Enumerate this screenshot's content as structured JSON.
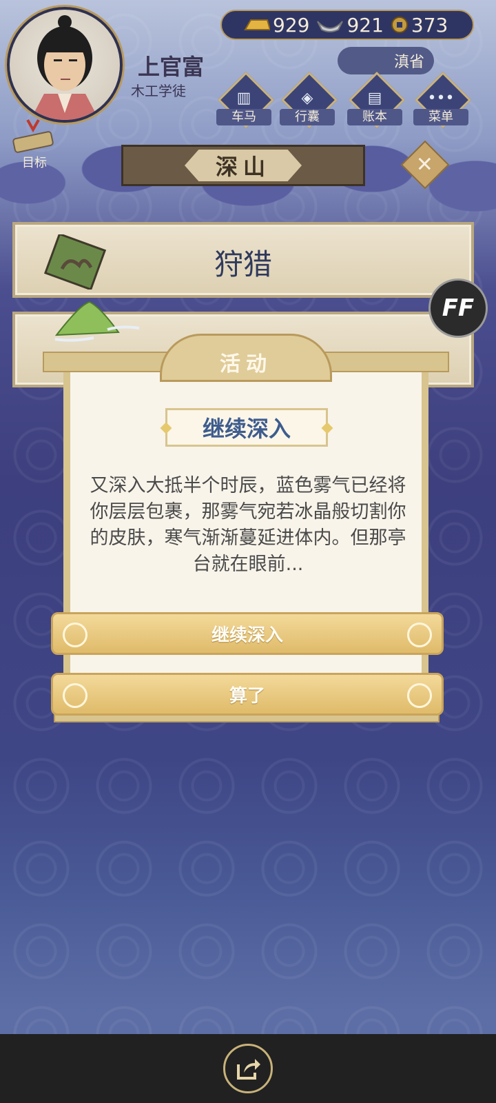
{
  "header": {
    "player_name": "上官富",
    "player_title": "木工学徒",
    "currencies": [
      {
        "icon": "gold-bar-icon",
        "value": "929"
      },
      {
        "icon": "silver-ingot-icon",
        "value": "921"
      },
      {
        "icon": "copper-coin-icon",
        "value": "373"
      }
    ],
    "province": "滇省",
    "nav": [
      {
        "label": "车马",
        "icon": "carriage-icon"
      },
      {
        "label": "行囊",
        "icon": "bag-icon"
      },
      {
        "label": "账本",
        "icon": "ledger-icon"
      },
      {
        "label": "菜单",
        "icon": "menu-dots-icon"
      }
    ],
    "goal_label": "目标"
  },
  "region": {
    "title": "深山"
  },
  "options": [
    {
      "label": "狩猎",
      "icon": "camel-icon"
    },
    {
      "label": "",
      "icon": "mountain-icon"
    }
  ],
  "dialog": {
    "title": "活动",
    "subtitle": "继续深入",
    "text": "又深入大抵半个时辰，蓝色雾气已经将你层层包裹，那雾气宛若冰晶般切割你的皮肤，寒气渐渐蔓延进体内。但那亭台就在眼前...",
    "buttons": [
      {
        "label": "继续深入"
      },
      {
        "label": "算了"
      }
    ]
  },
  "ff_label": "FF",
  "colors": {
    "accent_gold": "#d8c48e",
    "text_blue": "#3e5c8e",
    "bar_dark": "#2f3563"
  }
}
